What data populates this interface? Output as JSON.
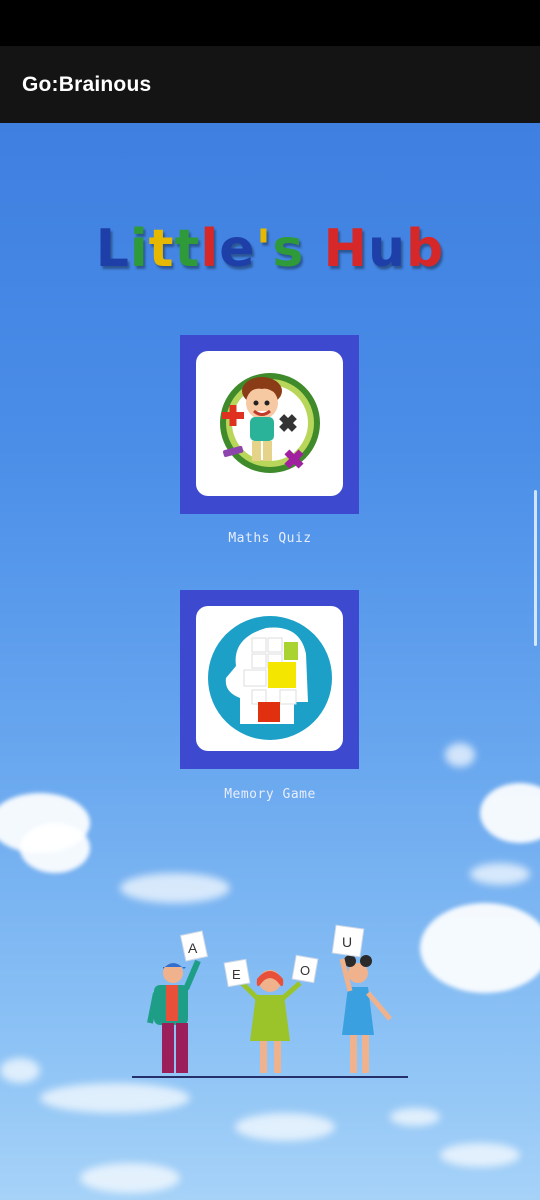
{
  "app_bar": {
    "title": "Go:Brainous"
  },
  "hub": {
    "title_letters": [
      {
        "ch": "L",
        "color": "#1e3fa8"
      },
      {
        "ch": "i",
        "color": "#2f9a3a"
      },
      {
        "ch": "t",
        "color": "#e6b800"
      },
      {
        "ch": "t",
        "color": "#2f9a3a"
      },
      {
        "ch": "l",
        "color": "#d62828"
      },
      {
        "ch": "e",
        "color": "#1e3fa8"
      },
      {
        "ch": "'",
        "color": "#e6b800"
      },
      {
        "ch": "s",
        "color": "#2f9a3a"
      },
      {
        "ch": " ",
        "color": "#000000"
      },
      {
        "ch": "H",
        "color": "#d62828"
      },
      {
        "ch": "u",
        "color": "#1e3fa8"
      },
      {
        "ch": "b",
        "color": "#d62828"
      }
    ]
  },
  "games": [
    {
      "label": "Maths Quiz",
      "icon": "boy-math-icon"
    },
    {
      "label": "Memory Game",
      "icon": "brain-memory-icon"
    }
  ],
  "illustration": {
    "cards": [
      "A",
      "E",
      "O",
      "U"
    ]
  }
}
